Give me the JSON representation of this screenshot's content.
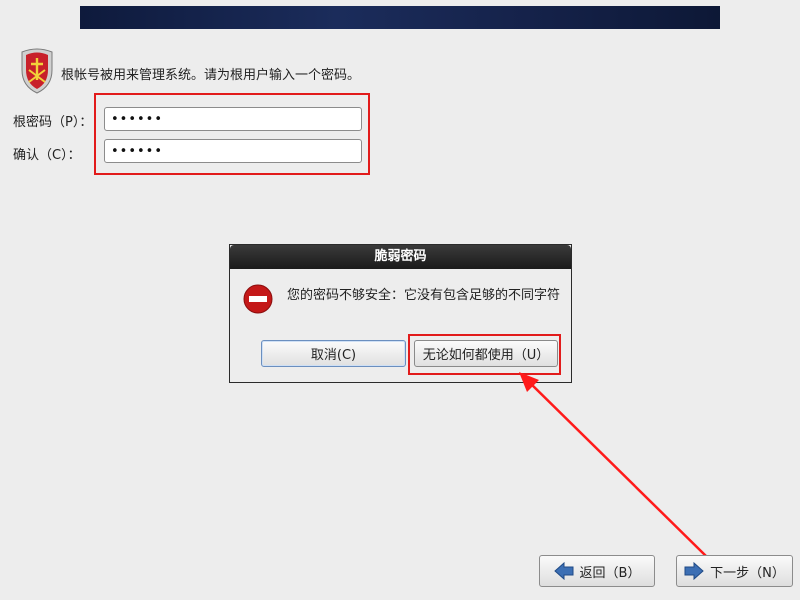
{
  "header": {
    "banner": ""
  },
  "intro": {
    "text": "根帐号被用来管理系统。请为根用户输入一个密码。"
  },
  "form": {
    "password_label": "根密码（P）：",
    "password_value": "••••••",
    "confirm_label": "确认（C）：",
    "confirm_value": "••••••"
  },
  "dialog": {
    "title": "脆弱密码",
    "message": "您的密码不够安全：它没有包含足够的不同字符",
    "cancel_label": "取消(C)",
    "use_anyway_label": "无论如何都使用（U）"
  },
  "nav": {
    "back_label": "返回（B）",
    "next_label": "下一步（N）"
  },
  "colors": {
    "highlight": "#e21b1b",
    "annotation_arrow": "#ff1a1a",
    "banner": "#15224a"
  },
  "icons": {
    "shield": "shield-icon",
    "stop": "stop-icon",
    "back": "arrow-left-icon",
    "next": "arrow-right-icon"
  }
}
